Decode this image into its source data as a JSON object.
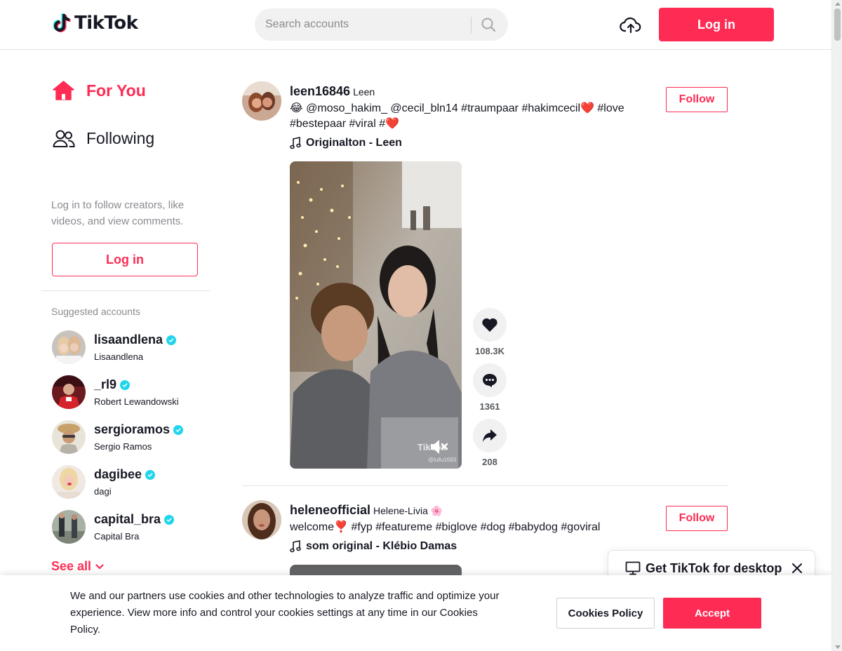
{
  "header": {
    "logo_text": "TikTok",
    "search_placeholder": "Search accounts",
    "login_label": "Log in"
  },
  "sidebar": {
    "nav": [
      {
        "label": "For You",
        "icon": "home-icon",
        "active": true
      },
      {
        "label": "Following",
        "icon": "users-icon",
        "active": false
      }
    ],
    "hint": "Log in to follow creators, like videos, and view comments.",
    "login_label": "Log in",
    "suggested_title": "Suggested accounts",
    "accounts": [
      {
        "username": "lisaandlena",
        "display": "Lisaandlena",
        "verified": true
      },
      {
        "username": "_rl9",
        "display": "Robert Lewandowski",
        "verified": true
      },
      {
        "username": "sergioramos",
        "display": "Sergio Ramos",
        "verified": true
      },
      {
        "username": "dagibee",
        "display": "dagi",
        "verified": true
      },
      {
        "username": "capital_bra",
        "display": "Capital Bra",
        "verified": true
      }
    ],
    "see_all": "See all"
  },
  "feed": {
    "posts": [
      {
        "username": "leen16846",
        "display": "Leen",
        "caption_line1": "😂 @moso_hakim_ @cecil_bln14 #traumpaar #hakimcecil❤️ #love",
        "caption_line2": "#bestepaar #viral #❤️",
        "music": "Originalton - Leen",
        "follow_label": "Follow",
        "watermark": "TikTok",
        "watermark_user": "@lullu1683",
        "likes": "108.3K",
        "comments": "1361",
        "shares": "208"
      },
      {
        "username": "heleneofficial",
        "display": "Helene-Livia 🌸",
        "caption_line1": "welcome❣️ #fyp #featureme #biglove #dog #babydog #goviral",
        "music": "som original - Klébio Damas",
        "follow_label": "Follow"
      }
    ]
  },
  "promo": {
    "label": "Get TikTok for desktop"
  },
  "cookie": {
    "text": "We and our partners use cookies and other technologies to analyze traffic and optimize your experience. View more info and control your cookies settings at any time in our Cookies Policy.",
    "policy_label": "Cookies Policy",
    "accept_label": "Accept"
  },
  "colors": {
    "accent": "#fe2c55",
    "text": "#161823",
    "muted": "#8a8b91",
    "verified": "#20d5ec"
  }
}
